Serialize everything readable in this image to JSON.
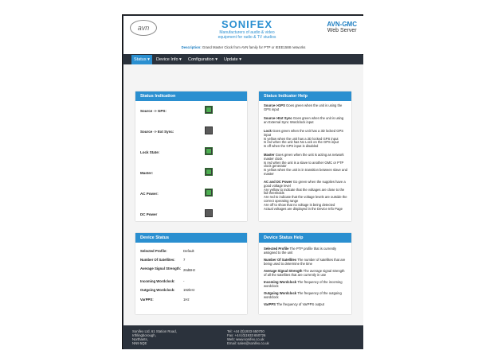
{
  "header": {
    "logo_text": "avn",
    "brand_name": "SONIFEX",
    "brand_tagline_1": "Manufacturers of audio & video",
    "brand_tagline_2": "equipment for radio & TV studios",
    "product_model": "AVN-GMC",
    "product_subtitle": "Web Server",
    "description_label": "Description:",
    "description_text": "Grand Master Clock from AVN family for PTP or IEEE1588 networks"
  },
  "nav": {
    "items": [
      {
        "label": "Status",
        "active": true
      },
      {
        "label": "Device Info",
        "active": false
      },
      {
        "label": "Configuration",
        "active": false
      },
      {
        "label": "Update",
        "active": false
      }
    ]
  },
  "status_indication": {
    "title": "Status Indication",
    "rows": [
      {
        "label": "Source -> GPS:",
        "state": "on"
      },
      {
        "label": "Source -> Ext Sync:",
        "state": "off"
      },
      {
        "label": "Lock State:",
        "state": "on"
      },
      {
        "label": "Master:",
        "state": "on"
      },
      {
        "label": "AC Power:",
        "state": "on"
      },
      {
        "label": "DC Power",
        "state": "off"
      }
    ]
  },
  "status_help": {
    "title": "Status Indicator Help",
    "paras": [
      {
        "term": "Source->GPS",
        "text": " Goes green when the unit is using the GPS input"
      },
      {
        "term": "Source->Ext Sync",
        "text": " Goes green when the unit is using an External Sync Wordclock input"
      },
      {
        "term": "Lock",
        "text": " Goes green when the unit has a 3D locked GPS input\nIs yellow when the unit has a 2D locked GPS input\nIs red when the unit has No Lock on the GPS input\nIs off when the GPS input is disabled"
      },
      {
        "term": "Master",
        "text": " Goes green when the unit is acting as network master clock\nIs red when the unit is a slave to another GMC or PTP clock generator\nIs yellow when the unit is in transition between slave and master"
      },
      {
        "term": "AC and DC Power",
        "text": " Go green when the supplies have a good voltage level\nAre yellow to indicate that the voltages are close to the fail thresholds\nAre red to indicate that the voltage levels are outside the correct operating range\nAre off to show that no voltage is being detected\nActual voltages are displayed in the Device Info Page"
      }
    ]
  },
  "device_status": {
    "title": "Device Status",
    "rows": [
      {
        "label": "Selected Profile:",
        "value": "Default"
      },
      {
        "label": "Number Of Satellites:",
        "value": "7"
      },
      {
        "label": "Average Signal Strength:",
        "value": "26dBHz"
      },
      {
        "label": "Incoming Wordclock:",
        "value": "-"
      },
      {
        "label": "Outgoing Wordclock:",
        "value": "192kHz"
      },
      {
        "label": "VarPPS:",
        "value": "1Hz"
      }
    ]
  },
  "device_help": {
    "title": "Device Status Help",
    "paras": [
      {
        "term": "Selected Profile",
        "text": " The PTP profile that is currently assigned to the unit"
      },
      {
        "term": "Number Of Satellites",
        "text": " The number of satellites that are being used to determine the time"
      },
      {
        "term": "Average Signal Strength",
        "text": " The average signal strength of all the satellites that are currently in use"
      },
      {
        "term": "Incoming Wordclock",
        "text": " The frequency of the incoming wordclock"
      },
      {
        "term": "Outgoing Wordclock",
        "text": " The frequency of the outgoing wordclock"
      },
      {
        "term": "VarPPS",
        "text": " The frequency of VarPPS output"
      }
    ]
  },
  "footer": {
    "address": [
      "Sonifex Ltd, 61 Station Road,",
      "Irthlingborough,",
      "Northants,",
      "NN9 5QE"
    ],
    "contact": [
      "Tel: +44 (0)1933 650700",
      "Fax: +44 (0)1933 650726",
      "Web: www.sonifex.co.uk",
      "Email: sales@sonifex.co.uk"
    ]
  },
  "colors": {
    "accent": "#2a8fd0",
    "dark": "#2b323c",
    "led_on": "#4caf50",
    "led_off": "#5a5a5a"
  }
}
